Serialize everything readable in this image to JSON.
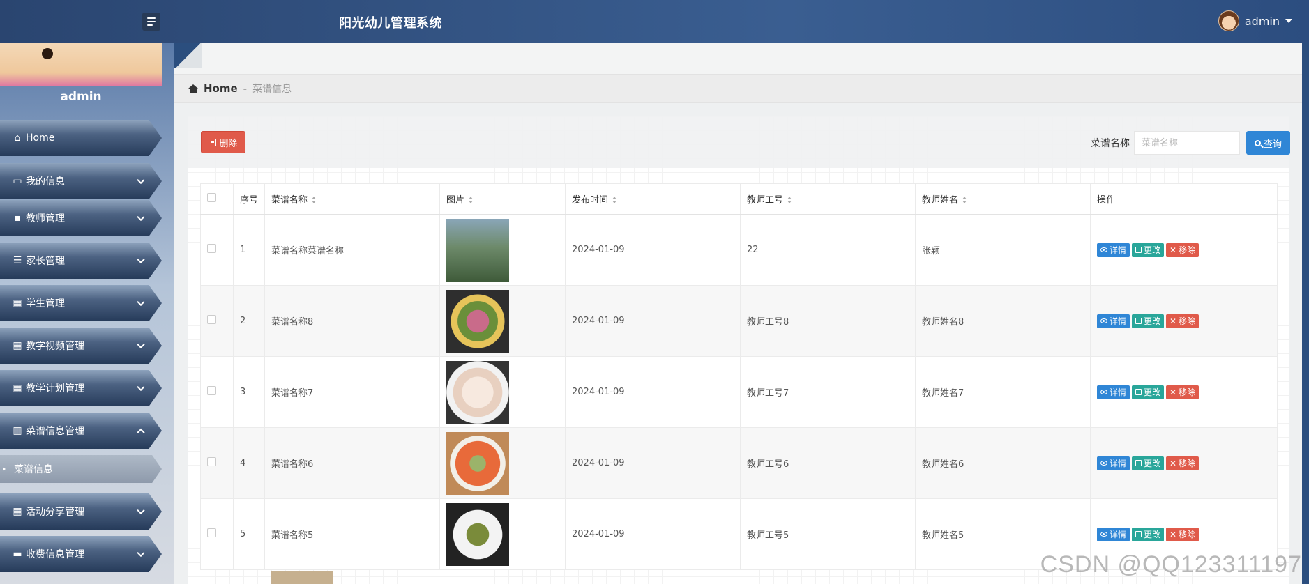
{
  "header": {
    "app_title": "阳光幼儿管理系统",
    "user": "admin"
  },
  "sidebar": {
    "profile_name": "admin",
    "items": [
      {
        "label": "Home",
        "icon": "home-icon"
      },
      {
        "label": "我的信息",
        "icon": "id-card-icon"
      },
      {
        "label": "教师管理",
        "icon": "chat-icon"
      },
      {
        "label": "家长管理",
        "icon": "list-icon"
      },
      {
        "label": "学生管理",
        "icon": "grid-icon"
      },
      {
        "label": "教学视频管理",
        "icon": "apps-icon"
      },
      {
        "label": "教学计划管理",
        "icon": "grid-icon"
      },
      {
        "label": "菜谱信息管理",
        "icon": "book-icon"
      },
      {
        "label": "活动分享管理",
        "icon": "grid-icon"
      },
      {
        "label": "收费信息管理",
        "icon": "ticket-icon"
      }
    ],
    "sub_item": "菜谱信息"
  },
  "breadcrumb": {
    "home": "Home",
    "separator": "-",
    "current": "菜谱信息"
  },
  "toolbar": {
    "delete_label": "删除",
    "search_label": "菜谱名称",
    "search_placeholder": "菜谱名称",
    "search_button": "查询"
  },
  "table": {
    "columns": [
      "序号",
      "菜谱名称",
      "图片",
      "发布时间",
      "教师工号",
      "教师姓名",
      "操作"
    ],
    "rows": [
      {
        "index": "1",
        "name": "菜谱名称菜谱名称",
        "date": "2024-01-09",
        "teacher_id": "22",
        "teacher_name": "张颖"
      },
      {
        "index": "2",
        "name": "菜谱名称8",
        "date": "2024-01-09",
        "teacher_id": "教师工号8",
        "teacher_name": "教师姓名8"
      },
      {
        "index": "3",
        "name": "菜谱名称7",
        "date": "2024-01-09",
        "teacher_id": "教师工号7",
        "teacher_name": "教师姓名7"
      },
      {
        "index": "4",
        "name": "菜谱名称6",
        "date": "2024-01-09",
        "teacher_id": "教师工号6",
        "teacher_name": "教师姓名6"
      },
      {
        "index": "5",
        "name": "菜谱名称5",
        "date": "2024-01-09",
        "teacher_id": "教师工号5",
        "teacher_name": "教师姓名5"
      }
    ],
    "actions": {
      "detail": "详情",
      "edit": "更改",
      "remove": "移除"
    }
  },
  "watermark": "CSDN @QQ123311197",
  "colors": {
    "header_bg": "#2a4570",
    "danger": "#e05a4a",
    "primary": "#2f86d6",
    "teal": "#29a69a"
  }
}
